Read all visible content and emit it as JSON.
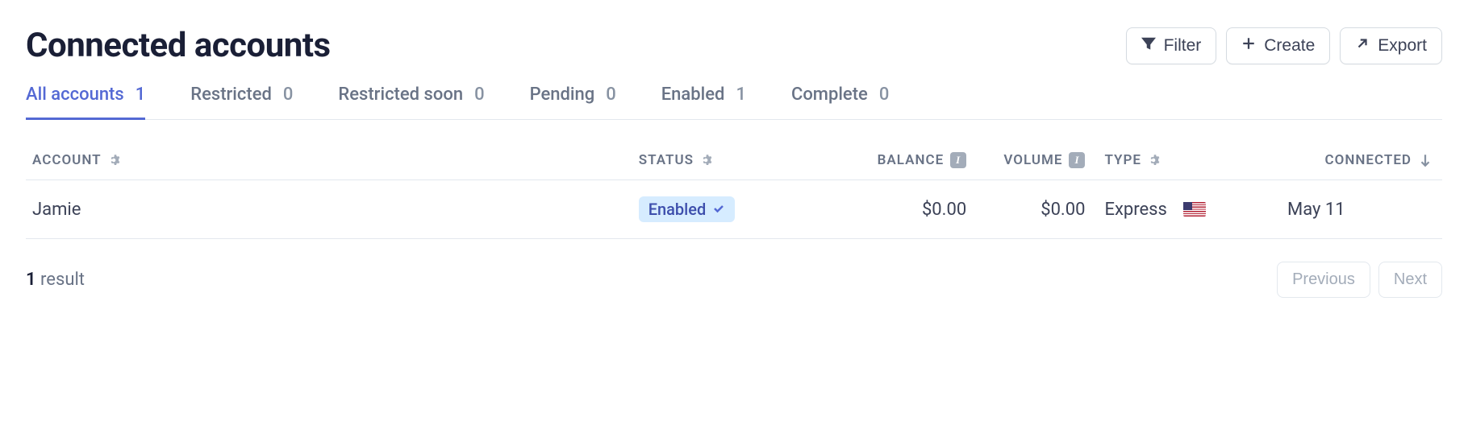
{
  "header": {
    "title": "Connected accounts",
    "buttons": {
      "filter": "Filter",
      "create": "Create",
      "export": "Export"
    }
  },
  "tabs": [
    {
      "label": "All accounts",
      "count": "1",
      "active": true
    },
    {
      "label": "Restricted",
      "count": "0",
      "active": false
    },
    {
      "label": "Restricted soon",
      "count": "0",
      "active": false
    },
    {
      "label": "Pending",
      "count": "0",
      "active": false
    },
    {
      "label": "Enabled",
      "count": "1",
      "active": false
    },
    {
      "label": "Complete",
      "count": "0",
      "active": false
    }
  ],
  "table": {
    "columns": {
      "account": "ACCOUNT",
      "status": "STATUS",
      "balance": "BALANCE",
      "volume": "VOLUME",
      "type": "TYPE",
      "connected": "CONNECTED"
    },
    "rows": [
      {
        "account": "Jamie",
        "status": "Enabled",
        "balance": "$0.00",
        "volume": "$0.00",
        "type": "Express",
        "country": "us",
        "connected": "May 11"
      }
    ]
  },
  "footer": {
    "result_count": "1",
    "result_label": "result",
    "previous": "Previous",
    "next": "Next"
  }
}
